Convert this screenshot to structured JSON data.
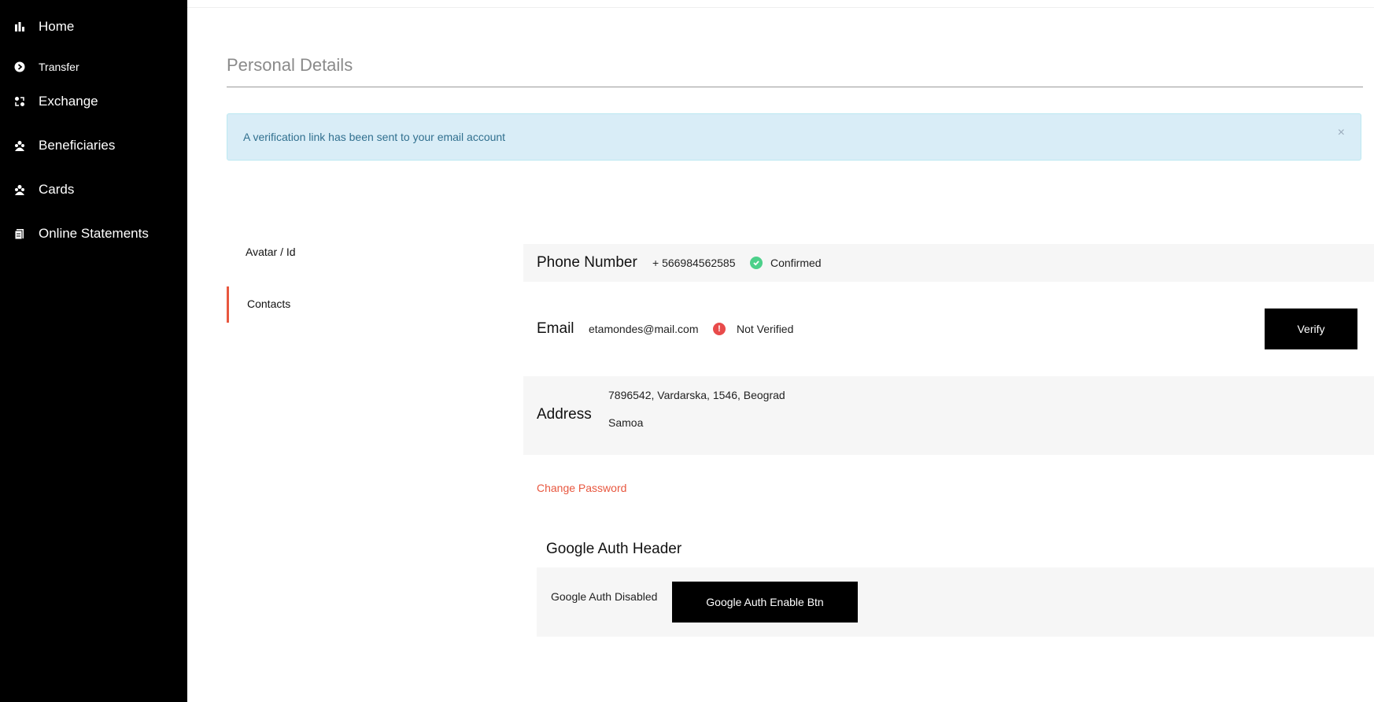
{
  "sidebar": {
    "items": [
      {
        "label": "Home",
        "icon": "bar-chart-icon"
      },
      {
        "label": "Transfer",
        "icon": "arrow-circle-icon"
      },
      {
        "label": "Exchange",
        "icon": "exchange-icon"
      },
      {
        "label": "Beneficiaries",
        "icon": "users-icon"
      },
      {
        "label": "Cards",
        "icon": "users-icon"
      },
      {
        "label": "Online Statements",
        "icon": "document-icon"
      }
    ]
  },
  "page": {
    "title": "Personal Details"
  },
  "alert": {
    "message": "A verification link has been sent to your email account",
    "close": "×"
  },
  "tabs": [
    {
      "label": "Avatar / Id"
    },
    {
      "label": "Contacts"
    }
  ],
  "contacts": {
    "phone": {
      "label": "Phone Number",
      "value": "+ 566984562585",
      "status": "Confirmed",
      "status_color": "#4cd08a"
    },
    "email": {
      "label": "Email",
      "value": "etamondes@mail.com",
      "status": "Not Verified",
      "status_color": "#e84b4b",
      "verify_label": "Verify"
    },
    "address": {
      "label": "Address",
      "line1": "7896542, Vardarska, 1546, Beograd",
      "line2": "Samoa"
    }
  },
  "change_password": "Change Password",
  "google_auth": {
    "header": "Google Auth Header",
    "status": "Google Auth Disabled",
    "button": "Google Auth Enable Btn"
  },
  "colors": {
    "accent": "#e8573f",
    "sidebar_bg": "#000000",
    "alert_bg": "#d9edf7",
    "alert_text": "#31708f"
  }
}
